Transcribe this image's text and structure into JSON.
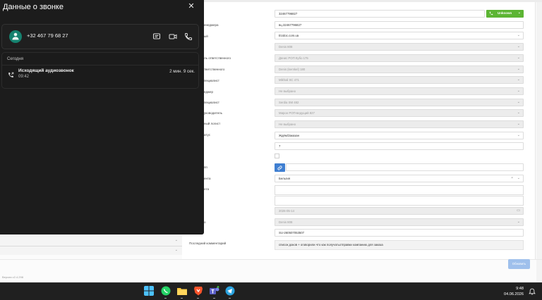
{
  "call_panel": {
    "title": "Данные о звонке",
    "close_glyph": "✕",
    "contact_number": "+32 467 79 68 27",
    "section_label": "Сегодня",
    "call": {
      "type": "Исходящий аудиозвонок",
      "time": "09:42",
      "duration": "2 мин. 9 сек."
    }
  },
  "form": {
    "phone_value": "32467796827",
    "status_label": "Unknown",
    "messenger_value": "вц.32467796827",
    "site_value": "EUdoc.com.ua",
    "labels": [
      "енеджера",
      "ый",
      "ль ответственного",
      "тветственного",
      "пециалист",
      "еджер",
      "пециалист",
      "уководитель",
      "ный логист",
      "атус",
      "пп",
      "ента",
      "нта",
      "о",
      "Последний комментарий"
    ],
    "fields": [
      "Denis 808",
      "Денис POП Кубо 175",
      "Denis (kernkel) 180",
      "Mikhail SC 471",
      "Не выбрано",
      "Serdia SM 482",
      "Мирон POП-ведущий 827",
      "Не выбрано"
    ],
    "deal_status": "Ждём/Заказан",
    "number_value": "7",
    "client_select": "Бельгия",
    "date_value": "2026-05-14",
    "responsible_value": "Denis 808",
    "order_number": "SU-260507053507",
    "last_comment": "список доков + оговорили что как получатьотправки компанию для заказа",
    "update_button": "Обновить",
    "version": "Версия v2.4.298"
  },
  "taskbar": {
    "time": "9:48",
    "date": "04.06.2026"
  },
  "colors": {
    "panel_bg": "#1c1c1c",
    "avatar": "#15826f",
    "status_green": "#5cb533",
    "link_blue": "#3f7fd1",
    "update_btn": "#9fc0ec"
  },
  "icons": [
    "user-icon",
    "message-icon",
    "video-icon",
    "phone-icon",
    "outgoing-call-icon",
    "close-icon",
    "link-icon",
    "windows-start-icon",
    "whatsapp-icon",
    "file-explorer-icon",
    "brave-icon",
    "teams-icon",
    "telegram-icon",
    "notifications-icon"
  ]
}
